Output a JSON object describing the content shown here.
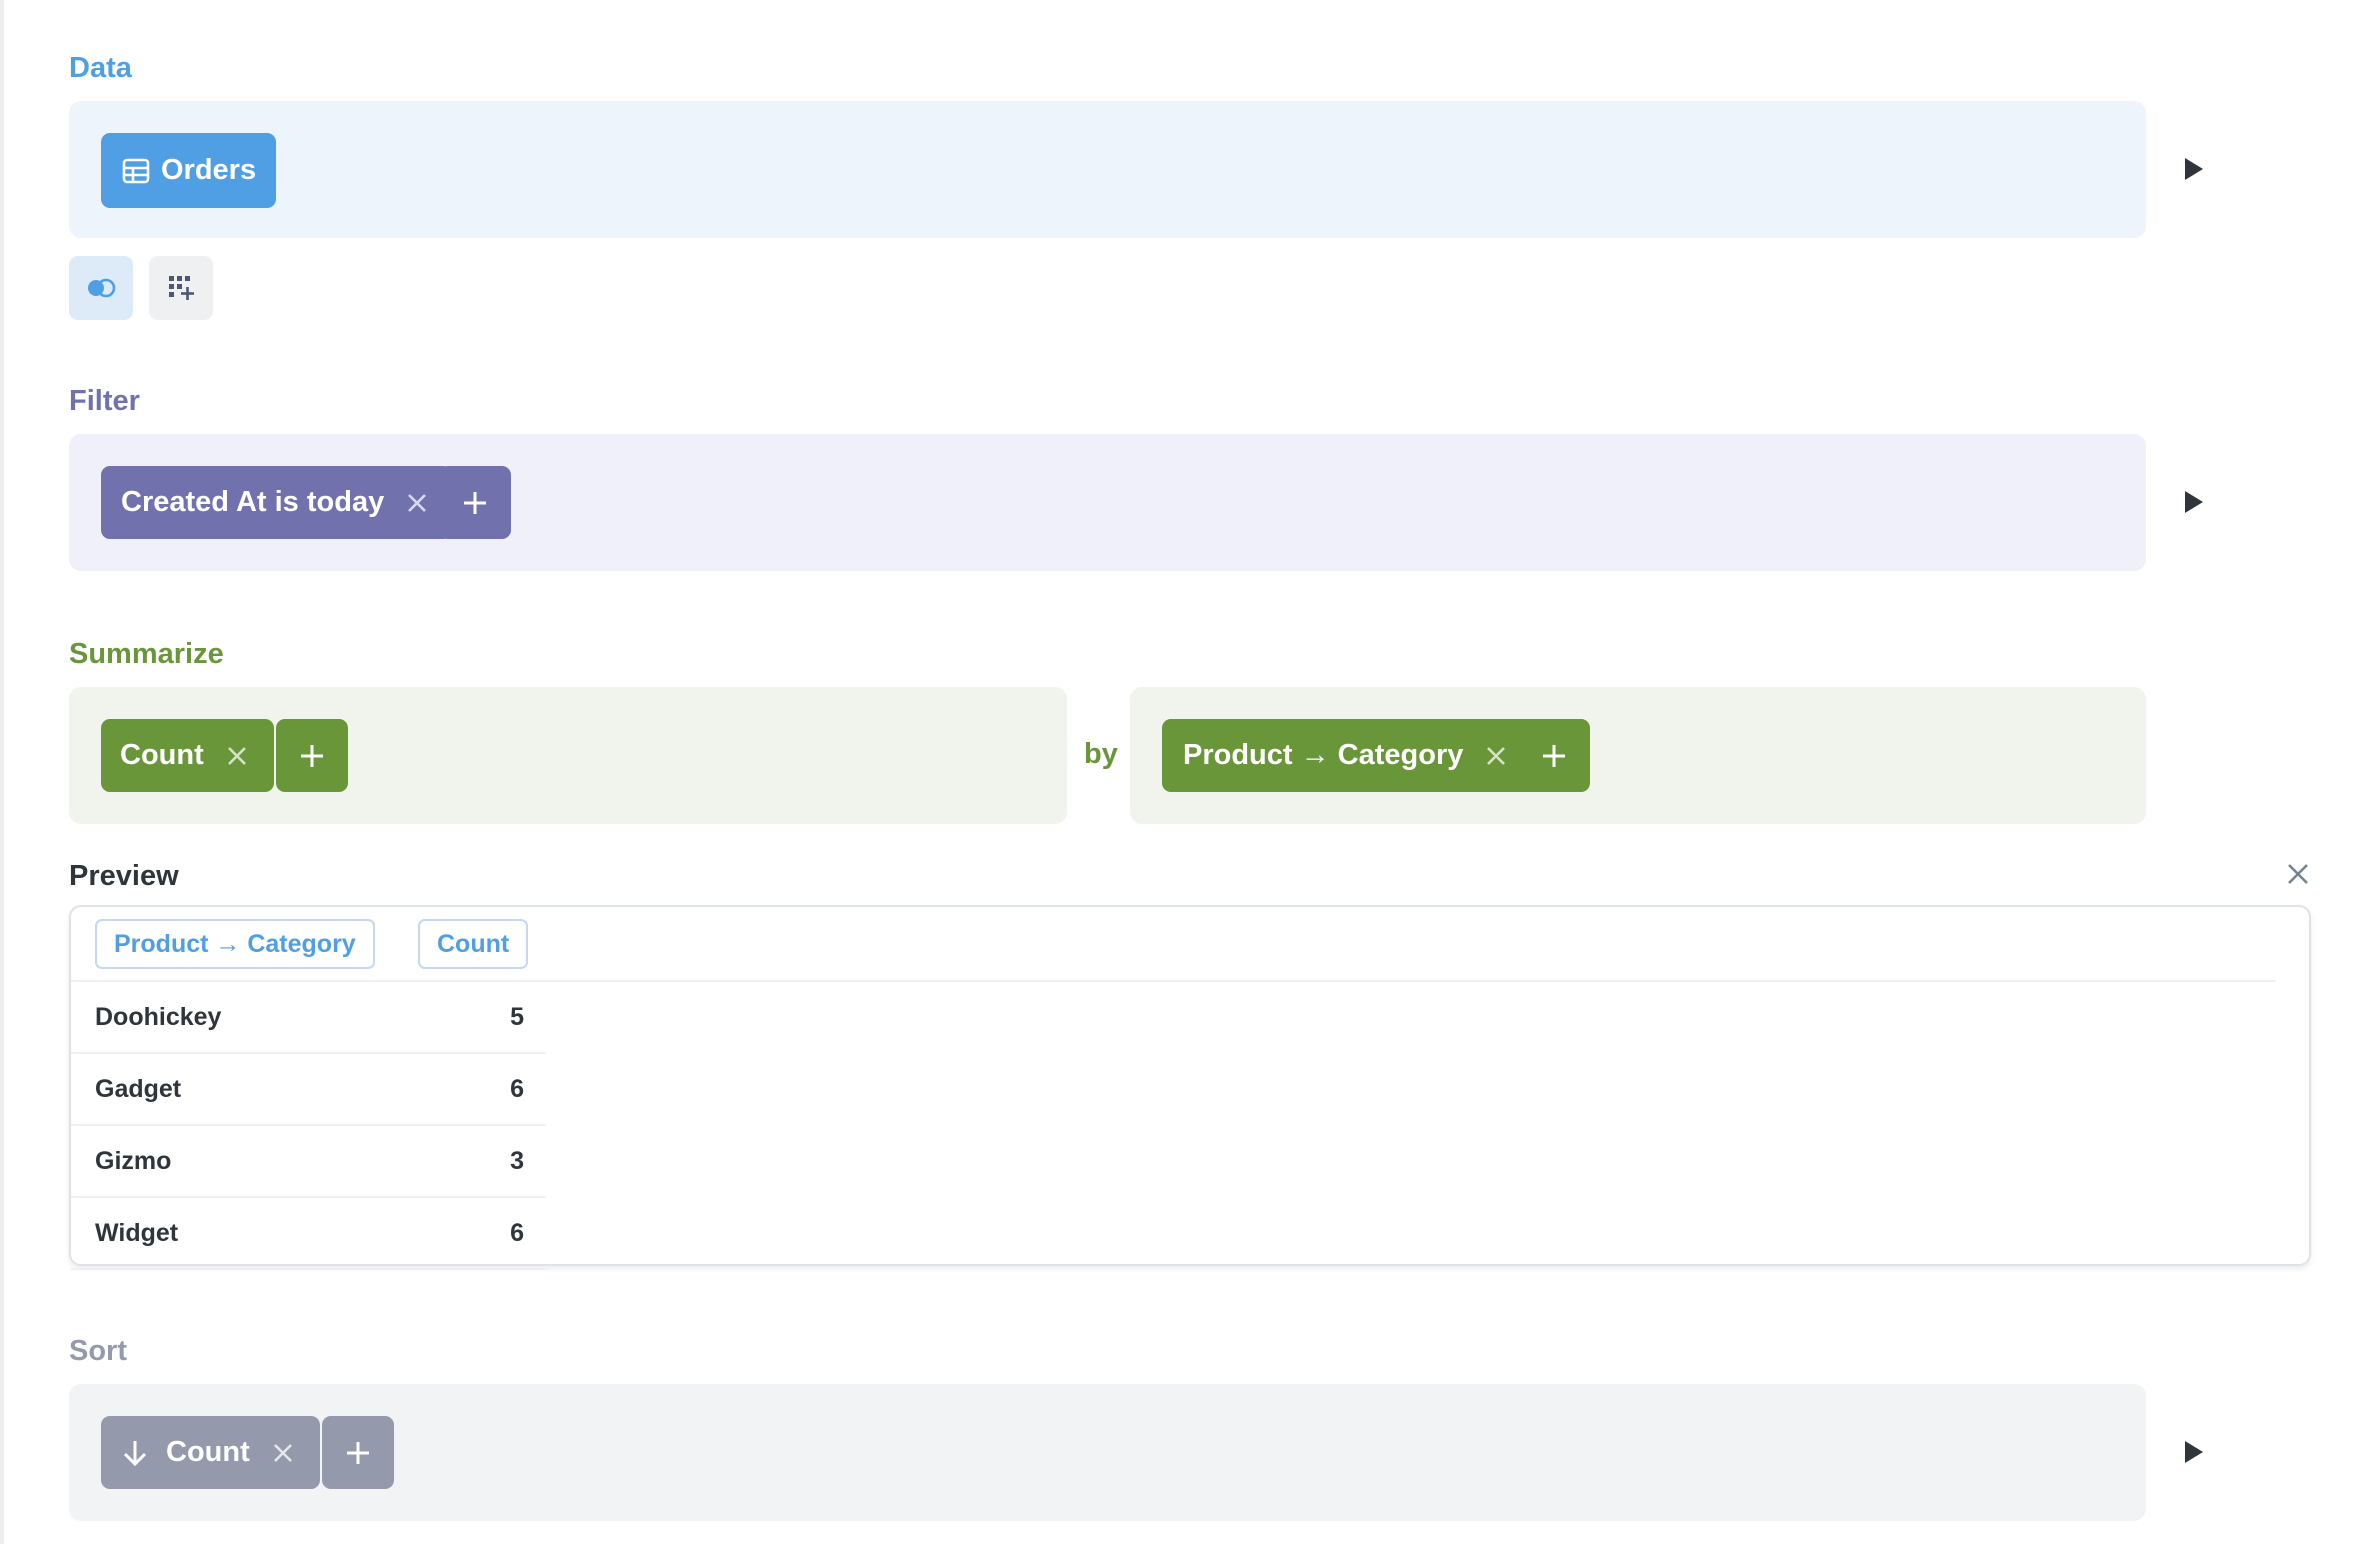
{
  "data_step": {
    "label": "Data",
    "table_button": "Orders",
    "color": "#509ee3",
    "tools": [
      "join-icon",
      "custom-column-icon"
    ]
  },
  "filter_step": {
    "label": "Filter",
    "filters": [
      "Created At is today"
    ],
    "color": "#7172ad"
  },
  "summarize_step": {
    "label": "Summarize",
    "metrics": [
      "Count"
    ],
    "by_label": "by",
    "breakouts": [
      "Product → Category"
    ],
    "color": "#6a963a"
  },
  "preview": {
    "label": "Preview",
    "columns": [
      "Product → Category",
      "Count"
    ],
    "rows": [
      {
        "category": "Doohickey",
        "count": "5"
      },
      {
        "category": "Gadget",
        "count": "6"
      },
      {
        "category": "Gizmo",
        "count": "3"
      },
      {
        "category": "Widget",
        "count": "6"
      }
    ]
  },
  "sort_step": {
    "label": "Sort",
    "sorts": [
      "Count"
    ],
    "direction": "descending",
    "color": "#949aab"
  }
}
